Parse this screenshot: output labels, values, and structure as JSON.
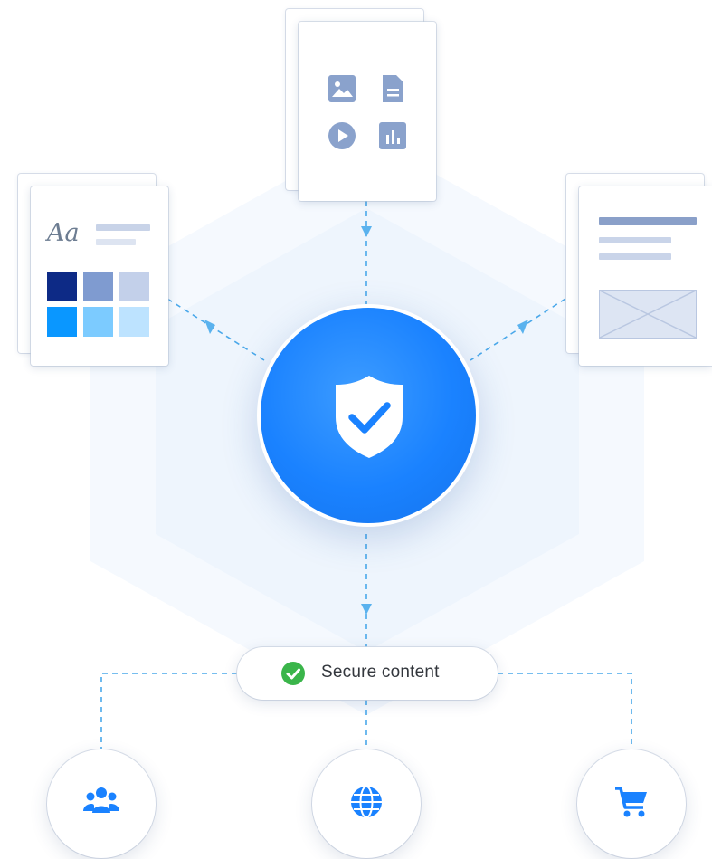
{
  "diagram": {
    "center_node": {
      "icon": "shield-check-icon",
      "color": "#1a82ff"
    },
    "source_cards": {
      "left": {
        "type": "brand-style-card",
        "typography_sample": "Aa",
        "swatches": [
          "#0d2a86",
          "#7f9bd0",
          "#c3d0ea",
          "#0a97ff",
          "#7ccbff",
          "#bde3ff"
        ]
      },
      "top": {
        "type": "media-card",
        "icons": [
          "image-icon",
          "document-icon",
          "play-icon",
          "chart-icon"
        ],
        "icon_color": "#8aa2cc"
      },
      "right": {
        "type": "layout-template-card",
        "accent": "#8aa0c9"
      }
    },
    "status_pill": {
      "icon": "check-circle-icon",
      "label": "Secure content",
      "icon_color": "#3ab54a"
    },
    "output_nodes": [
      {
        "icon": "users-icon"
      },
      {
        "icon": "globe-icon"
      },
      {
        "icon": "shopping-cart-icon"
      }
    ],
    "connector_color": "#4aa8ea"
  }
}
